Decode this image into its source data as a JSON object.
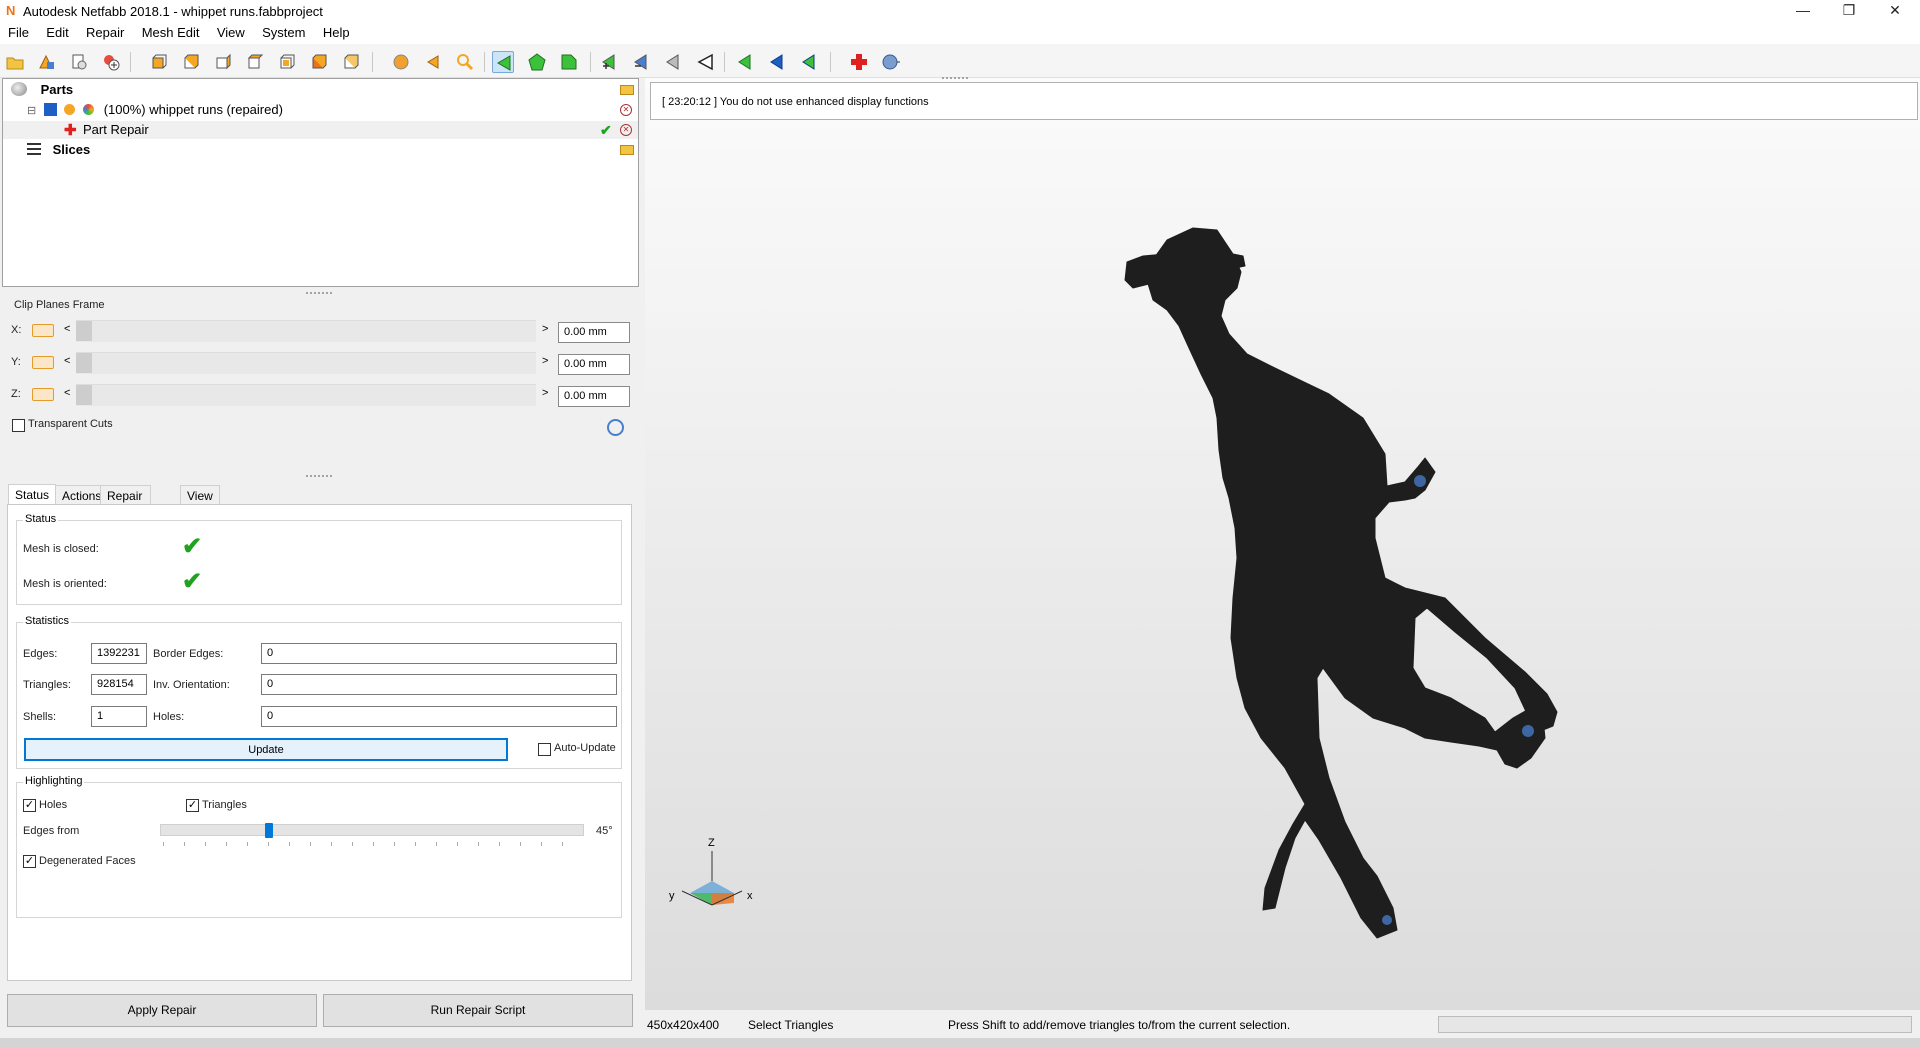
{
  "window": {
    "title": "Autodesk Netfabb 2018.1 - whippet runs.fabbproject",
    "logo": "N",
    "controls": [
      "minimize",
      "restore",
      "close"
    ]
  },
  "menu": [
    "File",
    "Edit",
    "Repair",
    "Mesh Edit",
    "View",
    "System",
    "Help"
  ],
  "tree": {
    "parts_label": "Parts",
    "part_name": "(100%) whippet runs (repaired)",
    "repair_label": "Part Repair",
    "slices_label": "Slices",
    "expand_symbol": "⊟"
  },
  "clip_planes": {
    "title": "Clip Planes Frame",
    "axes": [
      {
        "label": "X:",
        "value": "0.00 mm"
      },
      {
        "label": "Y:",
        "value": "0.00 mm"
      },
      {
        "label": "Z:",
        "value": "0.00 mm"
      }
    ],
    "transparent_cuts": "Transparent Cuts",
    "arrow_left": "<",
    "arrow_right": ">"
  },
  "tabs": [
    "Status",
    "Actions",
    "Repair Scripts",
    "View"
  ],
  "status": {
    "group_title": "Status",
    "closed_label": "Mesh is closed:",
    "oriented_label": "Mesh is oriented:",
    "check": "✔"
  },
  "statistics": {
    "group_title": "Statistics",
    "edges_label": "Edges:",
    "edges": "1392231",
    "border_edges_label": "Border Edges:",
    "border_edges": "0",
    "triangles_label": "Triangles:",
    "triangles": "928154",
    "inv_orientation_label": "Inv. Orientation:",
    "inv_orientation": "0",
    "shells_label": "Shells:",
    "shells": "1",
    "holes_label": "Holes:",
    "holes": "0",
    "update_button": "Update",
    "auto_update": "Auto-Update"
  },
  "highlighting": {
    "group_title": "Highlighting",
    "holes": "Holes",
    "triangles": "Triangles",
    "edges_from_label": "Edges from",
    "edges_from_value": "45°",
    "edges_from_fraction": 0.25,
    "degenerated_faces": "Degenerated Faces",
    "checked_mark": "✓"
  },
  "buttons": {
    "apply_repair": "Apply Repair",
    "run_repair_script": "Run Repair Script"
  },
  "viewport": {
    "log_message": "[ 23:20:12 ] You do not use enhanced display functions",
    "axis_z": "Z",
    "axis_y": "y",
    "axis_x": "x"
  },
  "statusbar": {
    "dimensions": "450x420x400",
    "mode": "Select Triangles",
    "hint": "Press Shift to add/remove triangles to/from the current selection."
  },
  "colors": {
    "accent": "#0078d7",
    "check_green": "#1fa31f",
    "model": "#1e1e1e",
    "highlight_blue": "#4a7fd0"
  }
}
